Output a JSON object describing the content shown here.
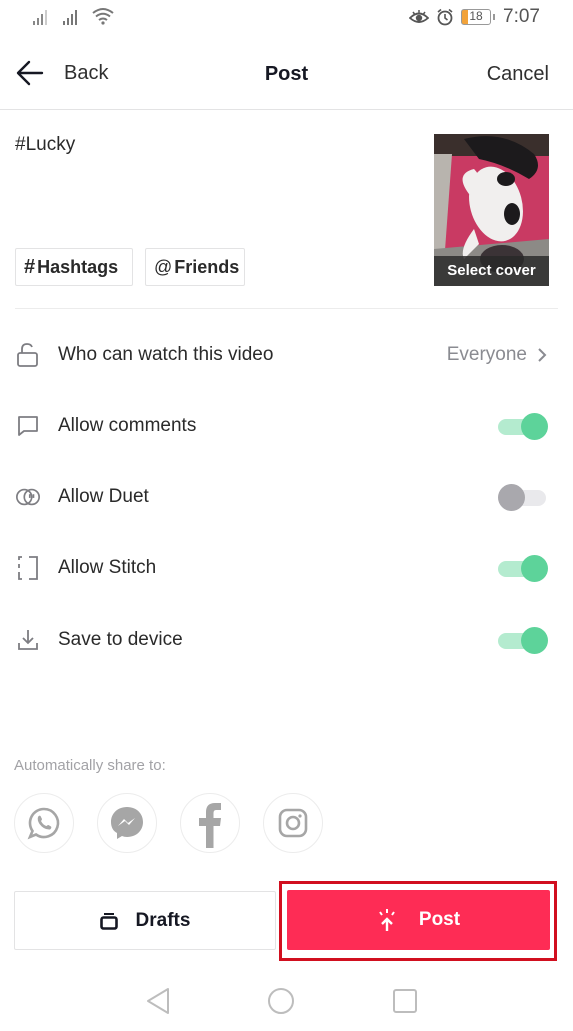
{
  "status_bar": {
    "time": "7:07",
    "battery_level": "18",
    "icons": [
      "signal-icon",
      "signal-icon",
      "wifi-icon",
      "eye-comfort-icon",
      "alarm-icon",
      "battery-icon"
    ]
  },
  "nav": {
    "back_label": "Back",
    "title": "Post",
    "cancel_label": "Cancel"
  },
  "caption": {
    "text": "#Lucky",
    "hashtags_button": "Hashtags",
    "hashtags_symbol": "#",
    "friends_button": "Friends",
    "friends_symbol": "@"
  },
  "cover": {
    "label": "Select cover"
  },
  "settings": {
    "who_can_watch": {
      "label": "Who can watch this video",
      "value": "Everyone"
    },
    "allow_comments": {
      "label": "Allow comments",
      "enabled": true
    },
    "allow_duet": {
      "label": "Allow Duet",
      "enabled": false
    },
    "allow_stitch": {
      "label": "Allow Stitch",
      "enabled": true
    },
    "save_to_device": {
      "label": "Save to device",
      "enabled": true
    }
  },
  "share": {
    "label": "Automatically share to:",
    "targets": [
      "WhatsApp",
      "Messenger",
      "Facebook",
      "Instagram"
    ]
  },
  "actions": {
    "drafts_label": "Drafts",
    "post_label": "Post"
  },
  "colors": {
    "accent": "#fe2c55",
    "toggle_on": "#5dd39a",
    "toggle_off": "#a9a8ad",
    "highlight_outline": "#d10f1f"
  }
}
